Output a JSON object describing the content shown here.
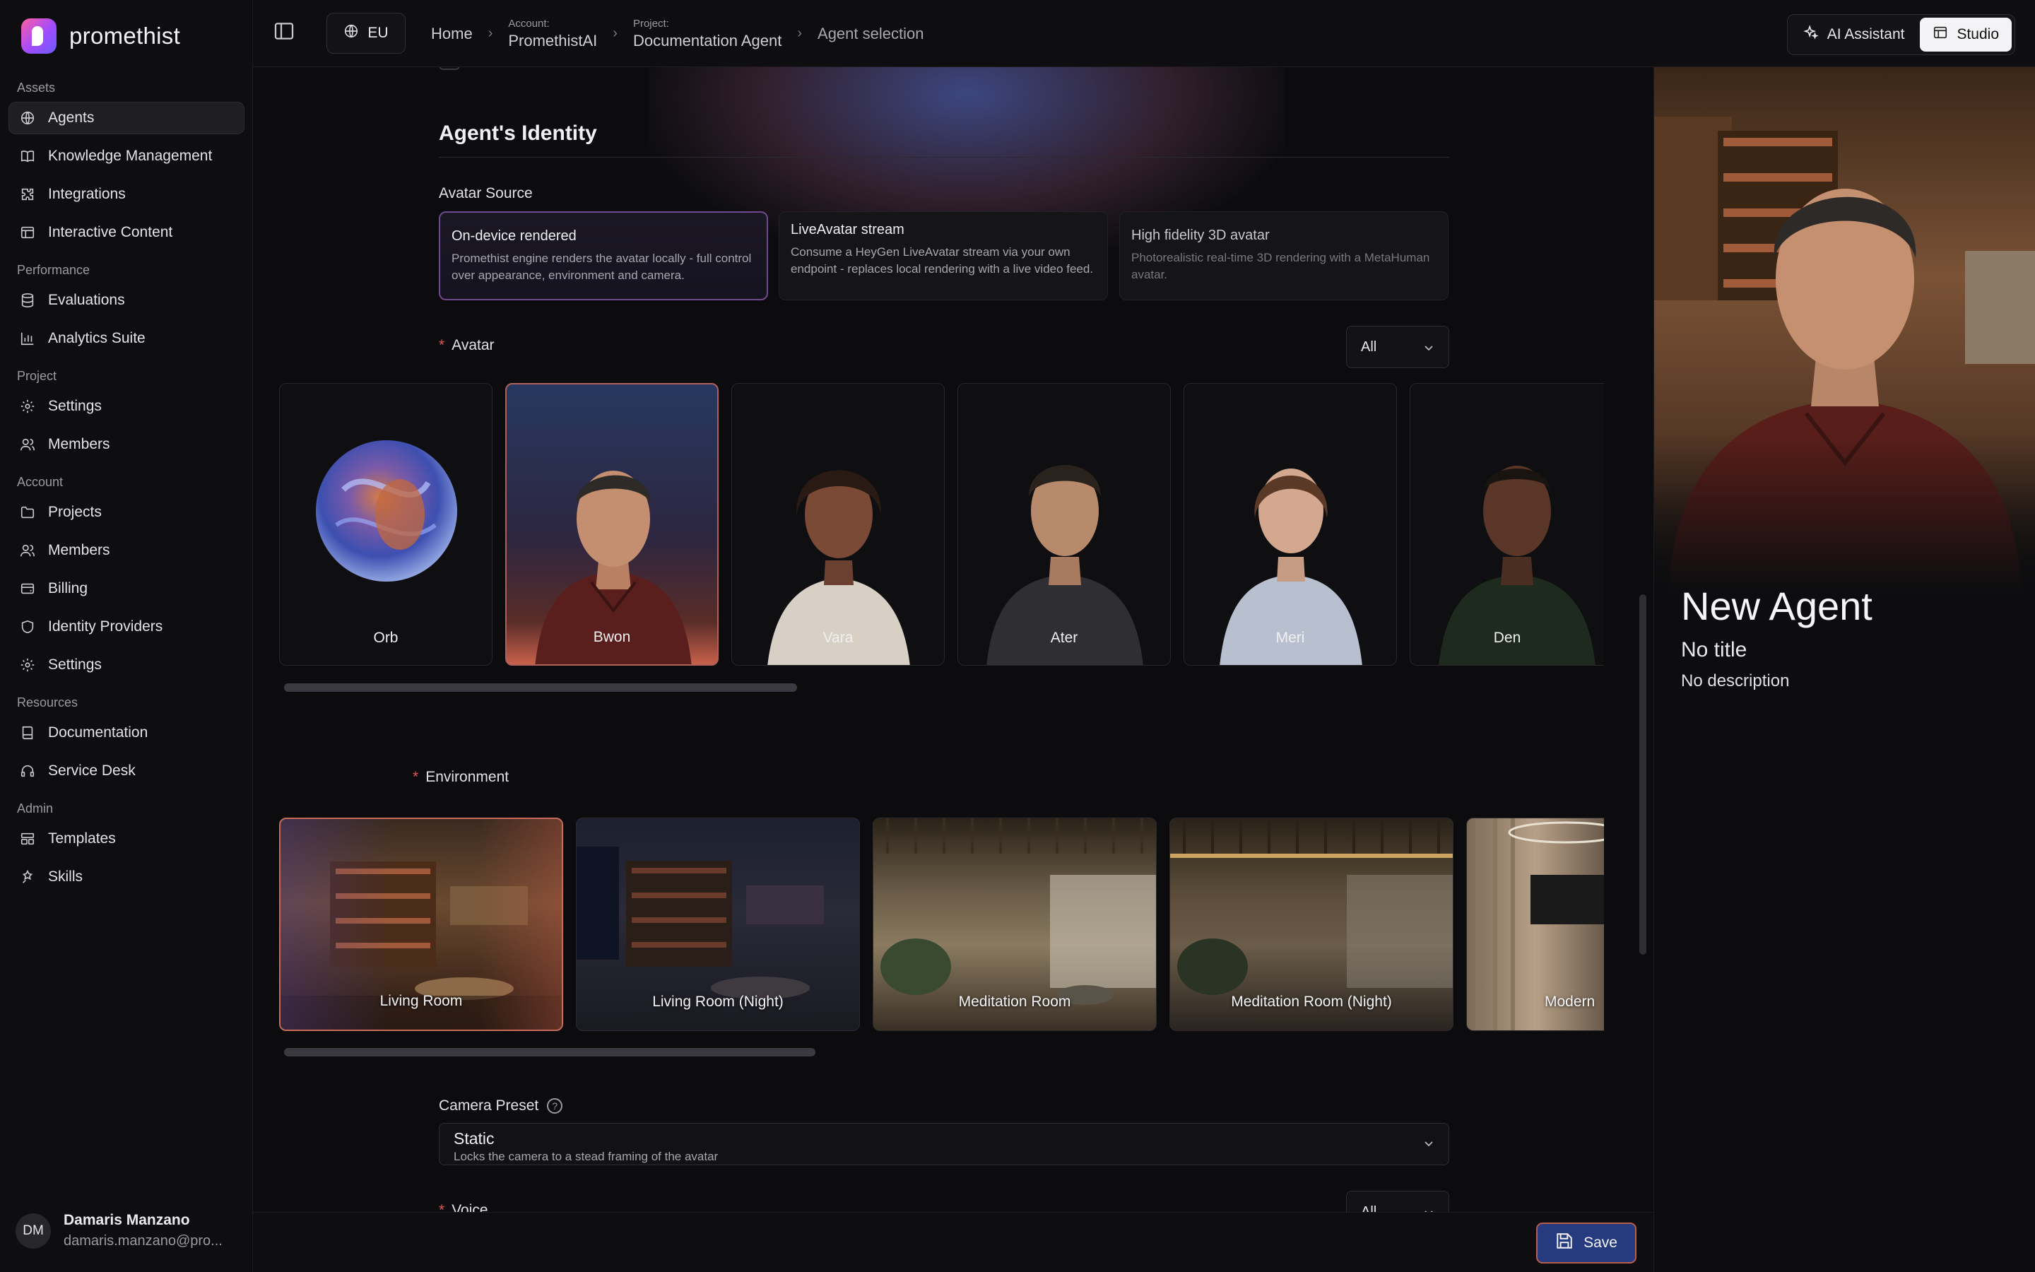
{
  "app": {
    "name": "promethist"
  },
  "sidebar": {
    "sections": [
      {
        "title": "Assets",
        "items": [
          {
            "label": "Agents",
            "icon": "globe-icon",
            "active": true
          },
          {
            "label": "Knowledge Management",
            "icon": "book-icon"
          },
          {
            "label": "Integrations",
            "icon": "puzzle-icon"
          },
          {
            "label": "Interactive Content",
            "icon": "layout-icon"
          }
        ]
      },
      {
        "title": "Performance",
        "items": [
          {
            "label": "Evaluations",
            "icon": "database-icon"
          },
          {
            "label": "Analytics Suite",
            "icon": "bar-chart-icon"
          }
        ]
      },
      {
        "title": "Project",
        "items": [
          {
            "label": "Settings",
            "icon": "gear-icon"
          },
          {
            "label": "Members",
            "icon": "users-icon"
          }
        ]
      },
      {
        "title": "Account",
        "items": [
          {
            "label": "Projects",
            "icon": "folder-icon"
          },
          {
            "label": "Members",
            "icon": "users-icon"
          },
          {
            "label": "Billing",
            "icon": "wallet-icon"
          },
          {
            "label": "Identity Providers",
            "icon": "shield-icon"
          },
          {
            "label": "Settings",
            "icon": "gear-icon"
          }
        ]
      },
      {
        "title": "Resources",
        "items": [
          {
            "label": "Documentation",
            "icon": "book-icon"
          },
          {
            "label": "Service Desk",
            "icon": "headset-icon"
          }
        ]
      },
      {
        "title": "Admin",
        "items": [
          {
            "label": "Templates",
            "icon": "template-icon"
          },
          {
            "label": "Skills",
            "icon": "skills-icon"
          }
        ]
      }
    ],
    "user": {
      "initials": "DM",
      "name": "Damaris Manzano",
      "email": "damaris.manzano@pro..."
    }
  },
  "topbar": {
    "region": "EU",
    "breadcrumb": {
      "home": "Home",
      "account_label": "Account:",
      "account": "PromethistAI",
      "project_label": "Project:",
      "project": "Documentation Agent",
      "current": "Agent selection"
    },
    "ai_assistant": "AI Assistant",
    "studio": "Studio"
  },
  "main": {
    "section_title": "Agent's Identity",
    "avatar_source_label": "Avatar Source",
    "sources": [
      {
        "title": "On-device rendered",
        "desc": "Promethist engine renders the avatar locally - full control over appearance, environment and camera.",
        "selected": true
      },
      {
        "title": "LiveAvatar stream",
        "desc": "Consume a HeyGen LiveAvatar stream via your own endpoint - replaces local rendering with a live video feed."
      },
      {
        "title": "High fidelity 3D avatar",
        "desc": "Photorealistic real-time 3D rendering with a MetaHuman avatar."
      }
    ],
    "avatar_label": "Avatar",
    "avatar_filter": "All",
    "avatars": [
      {
        "name": "Orb"
      },
      {
        "name": "Bwon",
        "selected": true
      },
      {
        "name": "Vara"
      },
      {
        "name": "Ater"
      },
      {
        "name": "Meri"
      },
      {
        "name": "Den"
      }
    ],
    "environment_label": "Environment",
    "environments": [
      {
        "name": "Living Room",
        "selected": true
      },
      {
        "name": "Living Room (Night)"
      },
      {
        "name": "Meditation Room"
      },
      {
        "name": "Meditation Room (Night)"
      },
      {
        "name": "Modern"
      }
    ],
    "camera_label": "Camera Preset",
    "camera_help": "?",
    "camera_value": "Static",
    "camera_desc": "Locks the camera to a stead framing of the avatar",
    "voice_label": "Voice",
    "voice_filter": "All",
    "save_label": "Save"
  },
  "preview": {
    "name": "New Agent",
    "title": "No title",
    "description": "No description"
  }
}
